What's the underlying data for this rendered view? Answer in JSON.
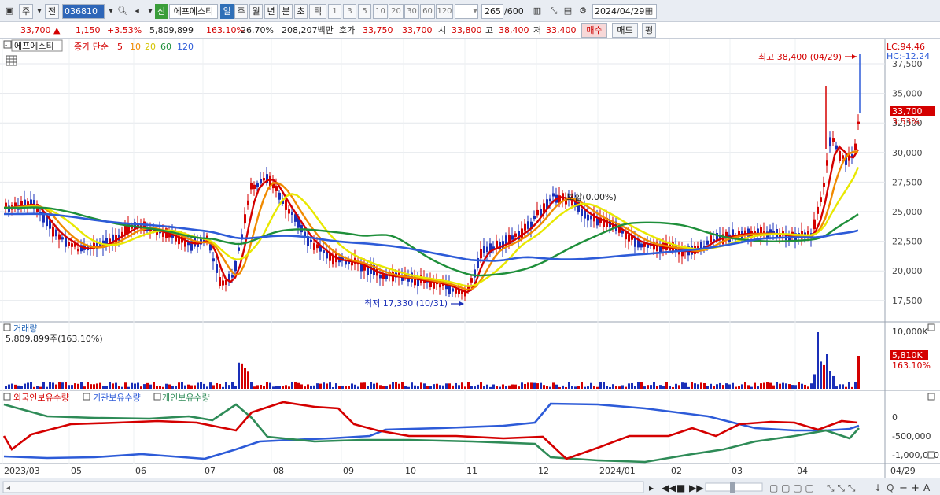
{
  "toolbar": {
    "type": "주",
    "prev": "전",
    "code": "036810",
    "badge": "신",
    "name": "에프에스티",
    "periods": [
      "일",
      "주",
      "월",
      "년",
      "분",
      "초",
      "틱"
    ],
    "minutes": [
      "1",
      "3",
      "5",
      "10",
      "20",
      "30",
      "60",
      "120"
    ],
    "count": "265",
    "max": "/600",
    "date": "2024/04/29"
  },
  "info": {
    "price": "33,700",
    "change": "1,150",
    "pct": "+3.53%",
    "volume": "5,809,899",
    "vol_pct": "163.10%",
    "turn": "26.70%",
    "amount": "208,207백만",
    "bid_label": "호가",
    "ask": "33,750",
    "bid": "33,700",
    "open_label": "시",
    "open": "33,800",
    "high_label": "고",
    "high": "38,400",
    "low_label": "저",
    "low": "33,400",
    "buy": "매수",
    "sell": "매도",
    "eval": "평"
  },
  "legend": {
    "name": "에프에스티",
    "close_label": "종가 단순",
    "ma": [
      "5",
      "10",
      "20",
      "60",
      "120"
    ],
    "ma_colors": [
      "#d40000",
      "#f08a00",
      "#e8e800",
      "#1e8f3a",
      "#2d5bd8"
    ]
  },
  "price_pane": {
    "lc": "LC:94.46",
    "hc": "HC:-12.24",
    "high_note": "최고 38,400 (04/29)",
    "low_note": "최저 17,330 (10/31)",
    "flat_note": "보합(0.00%)",
    "last_price": "33,700",
    "last_pct": "3.53%"
  },
  "volume_pane": {
    "title": "거래량",
    "value": "5,809,899주(163.10%)",
    "last_label": "5,810K",
    "last_pct": "163.10%"
  },
  "investor_pane": {
    "series": [
      "외국인보유수량",
      "기관보유수량",
      "개인보유수량"
    ],
    "colors": [
      "#d40000",
      "#2d5bd8",
      "#2e8b57"
    ]
  },
  "chart_data": {
    "type": "line",
    "y_axis_price": [
      "37,500",
      "35,000",
      "32,500",
      "30,000",
      "27,500",
      "25,000",
      "22,500",
      "20,000",
      "17,500"
    ],
    "y_axis_volume": [
      "10,000K"
    ],
    "y_axis_investor": [
      "0",
      "-500,000",
      "-1,000,000"
    ],
    "x_axis": [
      "2023/03",
      "05",
      "06",
      "07",
      "08",
      "09",
      "10",
      "11",
      "12",
      "2024/01",
      "02",
      "03",
      "04",
      "04/29"
    ]
  }
}
